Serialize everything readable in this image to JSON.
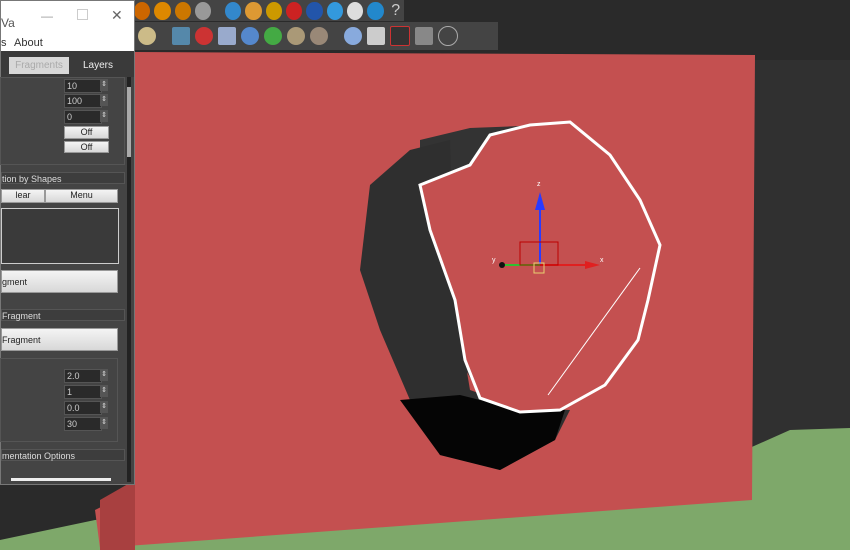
{
  "toolbar_top": {
    "icons": [
      "fire-icon",
      "fire-icon",
      "fire-icon",
      "scene-icon",
      "teapot-icon",
      "material-icon",
      "render-icon",
      "render-frame-icon",
      "light-icon",
      "environment-icon",
      "help-icon"
    ],
    "help_label": "?"
  },
  "toolbar_second": {
    "icons": [
      "sphere-icon",
      "grid-icon",
      "molecule-icon",
      "shape-icon",
      "particle-icon",
      "plant-icon",
      "hair-icon",
      "pan-icon",
      "globe-icon",
      "render-icon",
      "viewport-icon",
      "info-icon",
      "help-icon"
    ]
  },
  "window": {
    "title": "Va",
    "menu": {
      "about": "About"
    },
    "tabs": [
      {
        "label": "Fragments",
        "active": true
      },
      {
        "label": "Layers",
        "active": false
      }
    ],
    "spinners_top": [
      "10",
      "100",
      "0"
    ],
    "toggles": [
      "Off",
      "Off"
    ],
    "group_shapes": {
      "title": "tion by Shapes",
      "clear": "lear",
      "menu": "Menu"
    },
    "fragment_button": "gment",
    "group_fragment": {
      "title": "Fragment",
      "button": "Fragment"
    },
    "spinners_bottom": [
      "2.0",
      "1",
      "0.0",
      "30"
    ],
    "group_options": {
      "title": "mentation Options"
    }
  },
  "viewport": {
    "colors": {
      "wall": "#c45050",
      "ground": "#7ea86a",
      "background": "#2a2a2a"
    },
    "gizmo_axes": {
      "x": "x",
      "y": "y",
      "z": "z"
    }
  }
}
